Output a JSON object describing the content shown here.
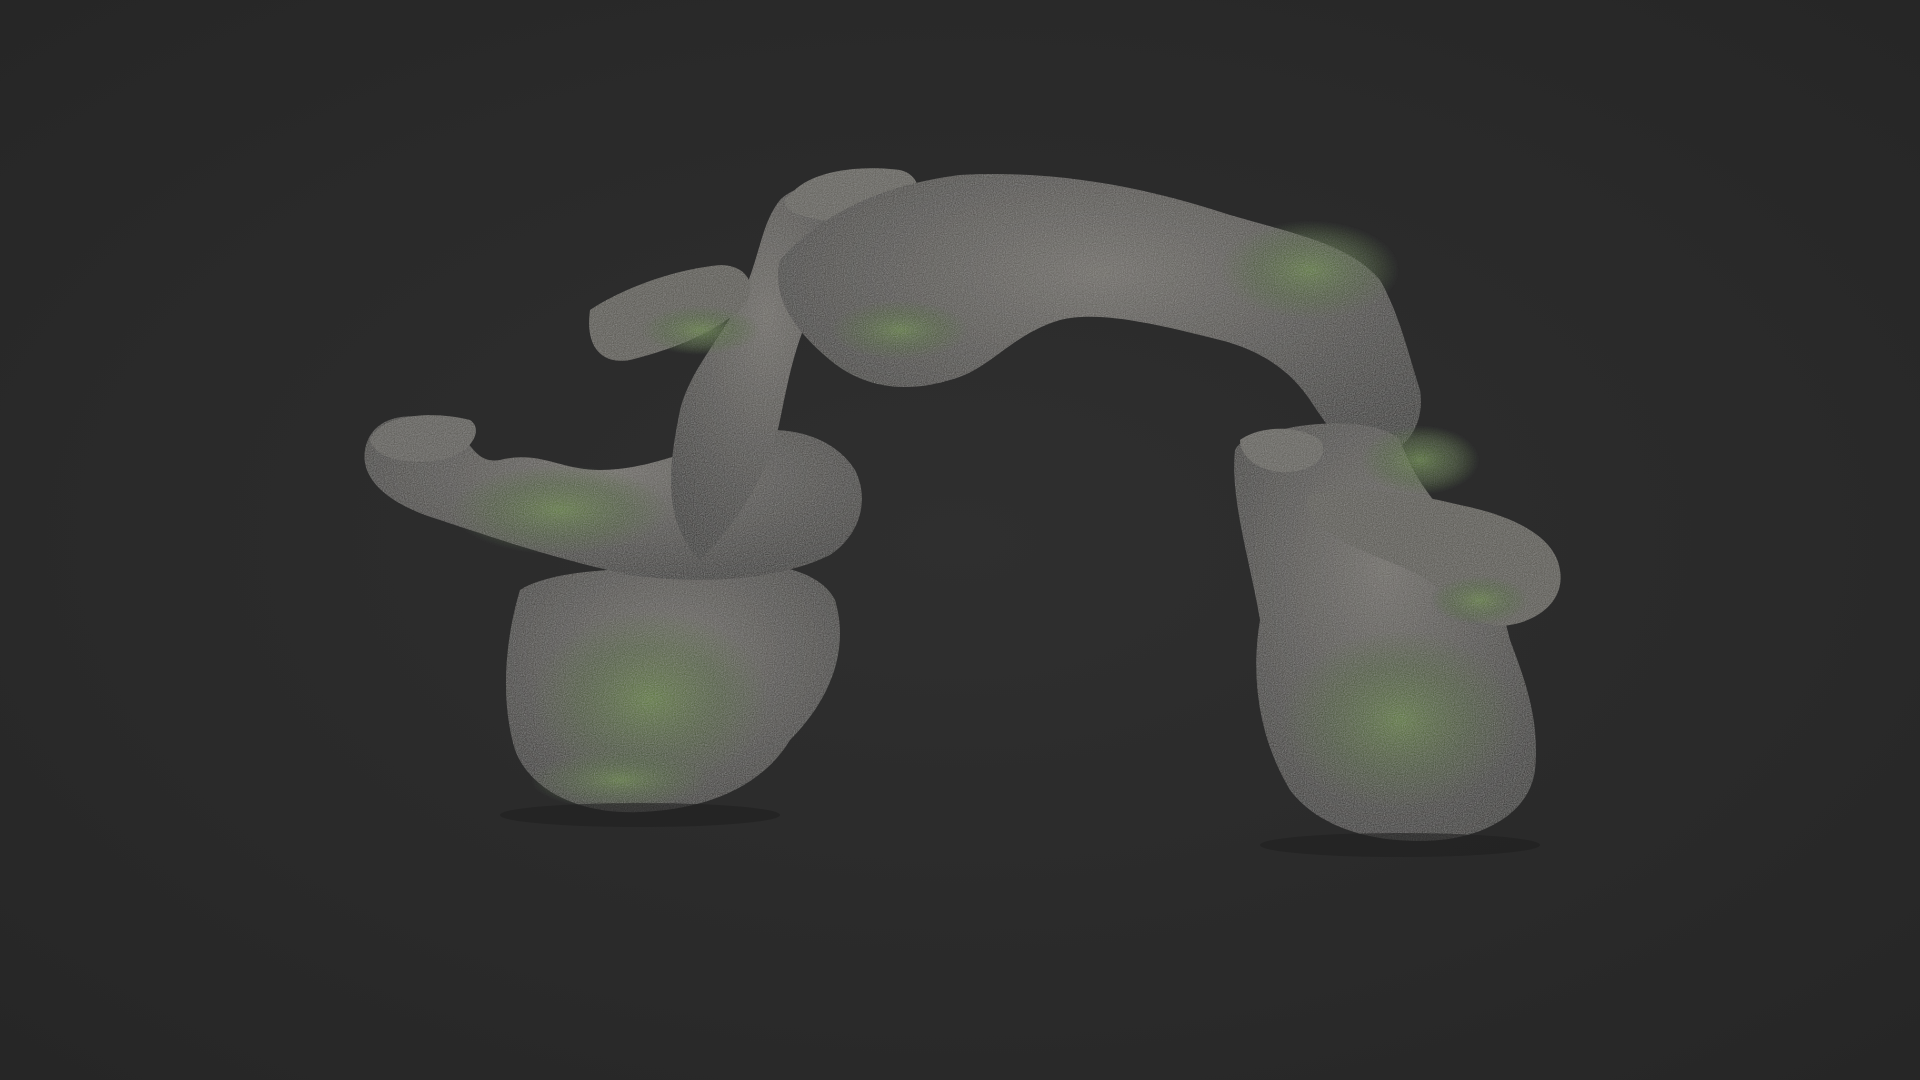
{
  "scene": {
    "subject": "rock-arch-model",
    "colors": {
      "background": "#2c2c2c",
      "rock_base": "#4a4844",
      "rock_light": "#6b6862",
      "rock_shadow": "#2a2927",
      "moss": "#3f5a22",
      "moss_bright": "#5c7f2c"
    }
  }
}
